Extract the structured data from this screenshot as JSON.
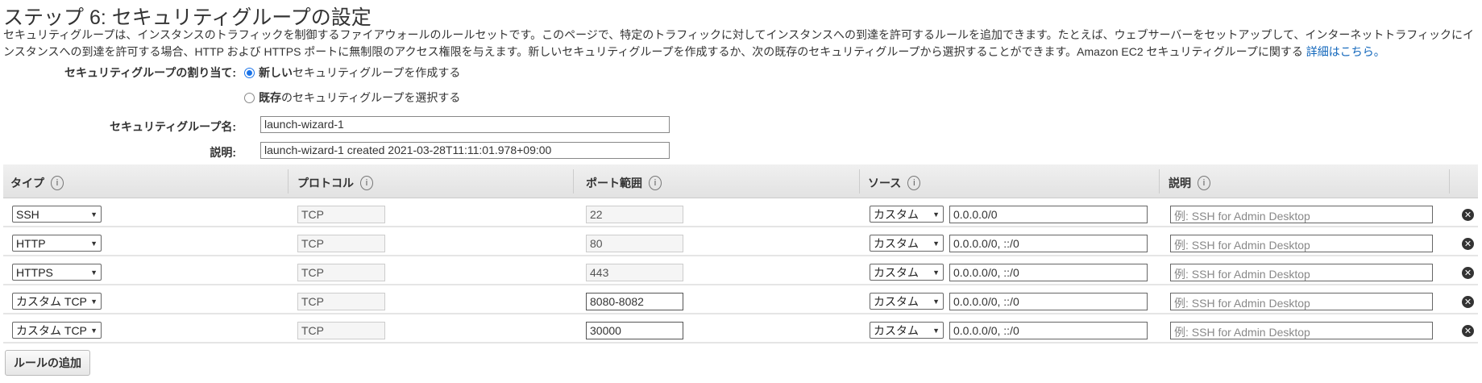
{
  "title": "ステップ 6: セキュリティグループの設定",
  "description": "セキュリティグループは、インスタンスのトラフィックを制御するファイアウォールのルールセットです。このページで、特定のトラフィックに対してインスタンスへの到達を許可するルールを追加できます。たとえば、ウェブサーバーをセットアップして、インターネットトラフィックにインスタンスへの到達を許可する場合、HTTP および HTTPS ポートに無制限のアクセス権限を与えます。新しいセキュリティグループを作成するか、次の既存のセキュリティグループから選択することができます。Amazon EC2 セキュリティグループに関する ",
  "learn_more": "詳細はこちら。",
  "assign": {
    "label": "セキュリティグループの割り当て:",
    "option_new_bold": "新しい",
    "option_new_rest": "セキュリティグループを作成する",
    "option_existing_bold": "既存",
    "option_existing_rest": "のセキュリティグループを選択する",
    "selected": "new"
  },
  "group_name": {
    "label": "セキュリティグループ名:",
    "value": "launch-wizard-1"
  },
  "group_desc": {
    "label": "説明:",
    "value": "launch-wizard-1 created 2021-03-28T11:11:01.978+09:00"
  },
  "table": {
    "headers": [
      "タイプ",
      "プロトコル",
      "ポート範囲",
      "ソース",
      "説明"
    ],
    "info_icon": "i",
    "rows": [
      {
        "type": "SSH",
        "protocol": "TCP",
        "port": "22",
        "port_editable": false,
        "source_type": "カスタム",
        "source": "0.0.0.0/0",
        "desc_placeholder": "例: SSH for Admin Desktop"
      },
      {
        "type": "HTTP",
        "protocol": "TCP",
        "port": "80",
        "port_editable": false,
        "source_type": "カスタム",
        "source": "0.0.0.0/0, ::/0",
        "desc_placeholder": "例: SSH for Admin Desktop"
      },
      {
        "type": "HTTPS",
        "protocol": "TCP",
        "port": "443",
        "port_editable": false,
        "source_type": "カスタム",
        "source": "0.0.0.0/0, ::/0",
        "desc_placeholder": "例: SSH for Admin Desktop"
      },
      {
        "type": "カスタム TCP",
        "protocol": "TCP",
        "port": "8080-8082",
        "port_editable": true,
        "source_type": "カスタム",
        "source": "0.0.0.0/0, ::/0",
        "desc_placeholder": "例: SSH for Admin Desktop"
      },
      {
        "type": "カスタム TCP",
        "protocol": "TCP",
        "port": "30000",
        "port_editable": true,
        "source_type": "カスタム",
        "source": "0.0.0.0/0, ::/0",
        "desc_placeholder": "例: SSH for Admin Desktop"
      }
    ]
  },
  "add_rule_label": "ルールの追加"
}
